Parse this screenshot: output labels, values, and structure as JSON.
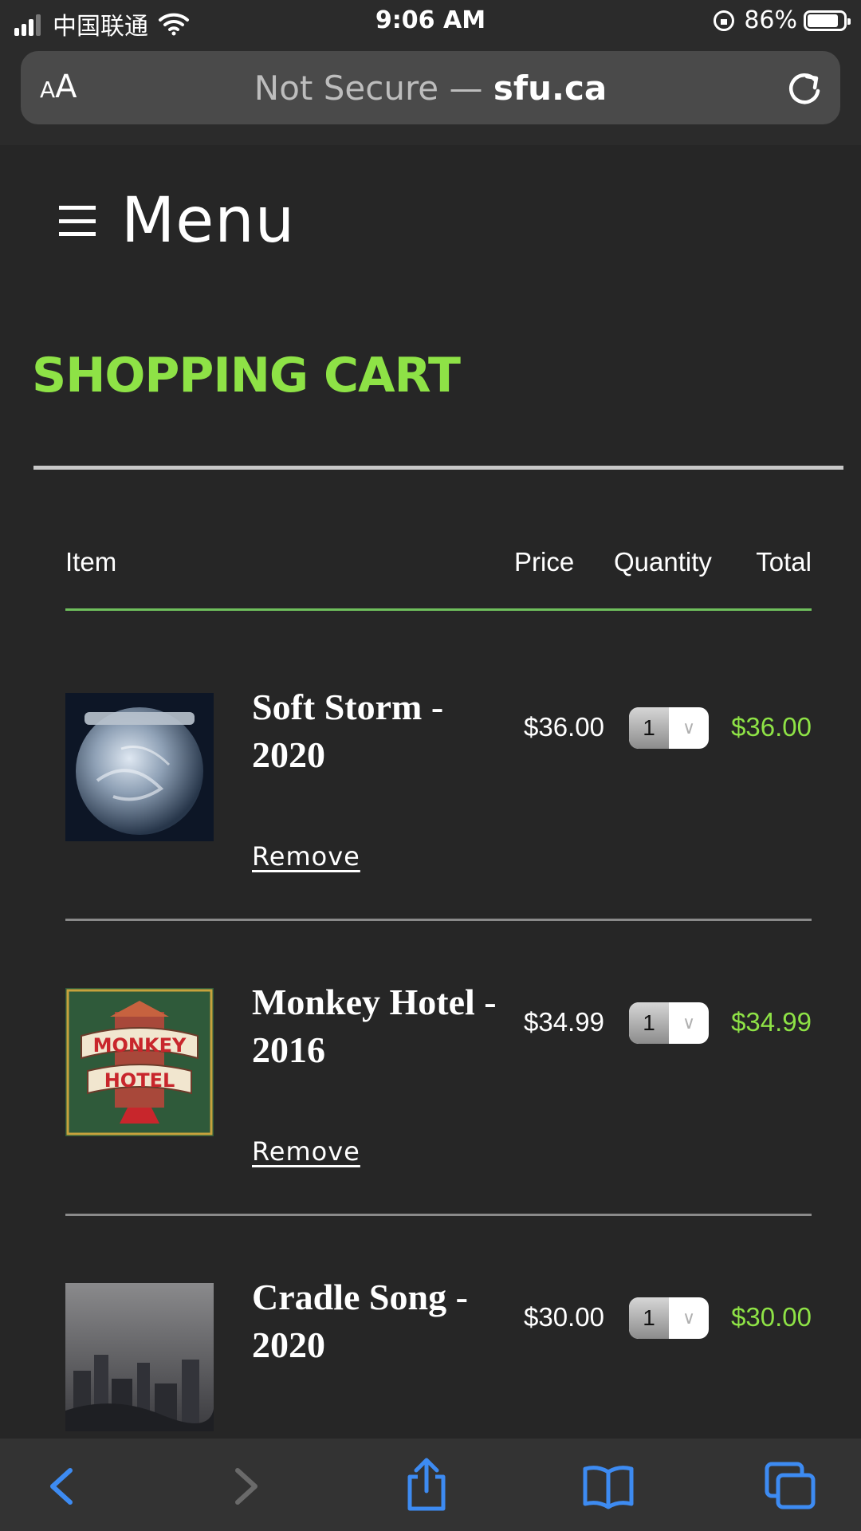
{
  "status_bar": {
    "carrier": "中国联通",
    "time": "9:06 AM",
    "battery": "86%",
    "battery_level": 0.86
  },
  "browser": {
    "text_size_button": "AA",
    "url_prefix": "Not Secure — ",
    "url_domain": "sfu.ca"
  },
  "menu": {
    "label": "Menu"
  },
  "cart": {
    "title": "SHOPPING CART",
    "headers": {
      "item": "Item",
      "price": "Price",
      "quantity": "Quantity",
      "total": "Total"
    },
    "remove_label": "Remove",
    "items": [
      {
        "name": "Soft Storm - 2020",
        "price": "$36.00",
        "quantity": "1",
        "total": "$36.00"
      },
      {
        "name": "Monkey Hotel - 2016",
        "price": "$34.99",
        "quantity": "1",
        "total": "$34.99",
        "art_text": [
          "MONKEY",
          "HOTEL"
        ]
      },
      {
        "name": "Cradle Song - 2020",
        "price": "$30.00",
        "quantity": "1",
        "total": "$30.00"
      }
    ]
  },
  "colors": {
    "accent_green": "#8ee246",
    "background": "#262626",
    "toolbar_blue": "#3d8bf2"
  },
  "toolbar": {
    "icons": [
      "back-icon",
      "forward-icon",
      "share-icon",
      "bookmarks-icon",
      "tabs-icon"
    ]
  }
}
